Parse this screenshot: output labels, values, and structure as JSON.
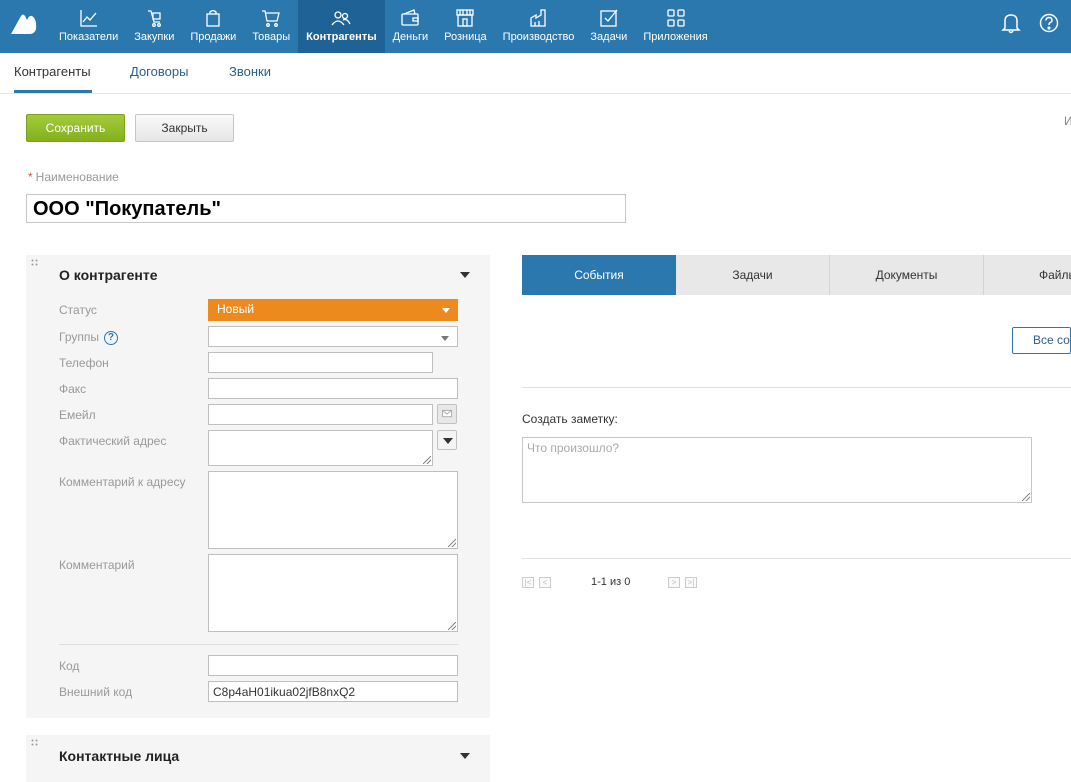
{
  "topnav": {
    "items": [
      {
        "label": "Показатели",
        "icon": "chart-icon"
      },
      {
        "label": "Закупки",
        "icon": "cart-hand-icon"
      },
      {
        "label": "Продажи",
        "icon": "bag-icon"
      },
      {
        "label": "Товары",
        "icon": "cart-icon"
      },
      {
        "label": "Контрагенты",
        "icon": "people-icon",
        "active": true
      },
      {
        "label": "Деньги",
        "icon": "wallet-icon"
      },
      {
        "label": "Розница",
        "icon": "store-icon"
      },
      {
        "label": "Производство",
        "icon": "factory-icon"
      },
      {
        "label": "Задачи",
        "icon": "checkbox-icon"
      },
      {
        "label": "Приложения",
        "icon": "apps-icon"
      }
    ],
    "bell_icon": "bell-icon",
    "help_icon": "help-icon"
  },
  "subnav": {
    "items": [
      "Контрагенты",
      "Договоры",
      "Звонки"
    ]
  },
  "toolbar": {
    "save_label": "Сохранить",
    "close_label": "Закрыть",
    "edge_text": "И"
  },
  "name": {
    "required_mark": "*",
    "label": "Наименование",
    "value": "ООО \"Покупатель\""
  },
  "about": {
    "title": "О контрагенте",
    "status_label": "Статус",
    "status_value": "Новый",
    "status_color": "#ec8a1e",
    "groups_label": "Группы",
    "help_glyph": "?",
    "phone_label": "Телефон",
    "fax_label": "Факс",
    "email_label": "Емейл",
    "address_label": "Фактический адрес",
    "address_comment_label": "Комментарий к адресу",
    "comment_label": "Комментарий",
    "code_label": "Код",
    "ext_code_label": "Внешний код",
    "ext_code_value": "C8p4aH01ikua02jfB8nxQ2"
  },
  "contacts": {
    "title": "Контактные лица"
  },
  "tabs": [
    "События",
    "Задачи",
    "Документы",
    "Файлы"
  ],
  "events": {
    "all_button": "Все события",
    "note_label": "Создать заметку:",
    "note_placeholder": "Что произошло?",
    "pager_text": "1-1 из 0"
  },
  "colors": {
    "topbar": "#2b78ae",
    "accent": "#2b78ae",
    "save": "#8dba24"
  }
}
